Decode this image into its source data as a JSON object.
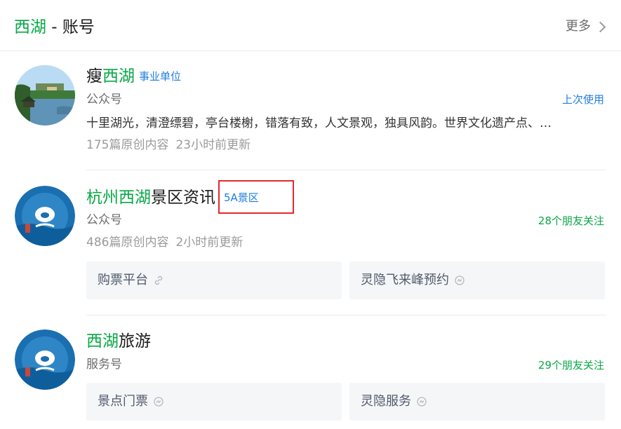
{
  "header": {
    "title_highlight": "西湖",
    "title_rest": " - 账号",
    "more_label": "更多"
  },
  "accounts": [
    {
      "name_highlight": "瘦西湖",
      "name_prefix_plain": "瘦",
      "name_green": "西湖",
      "name_rest": "",
      "tag": "事业单位",
      "type": "公众号",
      "right_note": "上次使用",
      "description": "十里湖光，清澄缥碧，亭台楼榭，错落有致，人文景观，独具风韵。世界文化遗产点、…",
      "articles": "175篇原创内容",
      "updated": "23小时前更新"
    },
    {
      "name_prefix_plain": "",
      "name_green": "杭州西湖",
      "name_rest": "景区资讯",
      "tag": "5A景区",
      "type": "公众号",
      "right_note": "28个朋友关注",
      "articles": "486篇原创内容",
      "updated": "2小时前更新",
      "links": [
        "购票平台",
        "灵隐飞来峰预约"
      ]
    },
    {
      "name_prefix_plain": "",
      "name_green": "西湖",
      "name_rest": "旅游",
      "type": "服务号",
      "right_note": "29个朋友关注",
      "links": [
        "景点门票",
        "灵隐服务"
      ]
    }
  ],
  "colors": {
    "highlight_green": "#07a845",
    "tag_blue": "#1f7ee0",
    "annotation_red": "#e0292f"
  },
  "icons": {
    "link": "link-icon",
    "miniprogram": "mini-program-icon",
    "chevron": "chevron-right-icon"
  }
}
